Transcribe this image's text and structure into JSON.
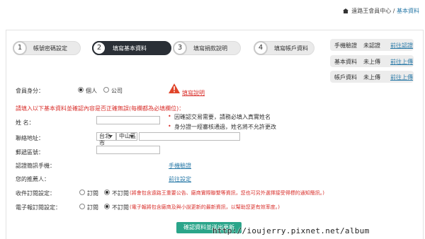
{
  "breadcrumb": {
    "home": "遠路王會員中心",
    "sep": "/",
    "current": "基本資料"
  },
  "steps": [
    {
      "num": "1",
      "label": "帳號密碼設定"
    },
    {
      "num": "2",
      "label": "填寫基本資料"
    },
    {
      "num": "3",
      "label": "填寫捐款說明"
    },
    {
      "num": "4",
      "label": "填寫帳戶資料"
    }
  ],
  "status": [
    {
      "key": "手機驗證",
      "value": "未認證",
      "action": "前往認證"
    },
    {
      "key": "基本資料",
      "value": "未上傳",
      "action": "前往上傳"
    },
    {
      "key": "帳戶資料",
      "value": "未上傳",
      "action": "前往上傳"
    }
  ],
  "form": {
    "member_label": "會員身分：",
    "member_options": [
      "個人",
      "公司"
    ],
    "member_selected": "個人",
    "explain_link": "填寫說明",
    "notice": "請填入以下基本資料並確認內容是否正確無誤(每欄都為必填欄位)：",
    "name_label": "姓 名：",
    "name_hints": [
      "因確認交易需要，請務必填入真實姓名",
      "身分證一經審核通過，姓名將不允許更改"
    ],
    "address_label": "聯絡地址：",
    "city": "台北市",
    "district": "中山區",
    "zip_label": "郵遞區號：",
    "phone_label": "認證簡訊手機：",
    "phone_link": "手機驗證",
    "recommender_label": "您的推薦人：",
    "recommender_link": "前往設定",
    "order_label": "收件訂閱設定：",
    "epaper_label": "電子報訂閱設定：",
    "sub_options": [
      "訂閱",
      "不訂閱"
    ],
    "sub_selected": "不訂閱",
    "order_note": "(將會包含遠路王重要公告、廠商實際聯繫等資訊，您也可另外選擇接受得標的通知簡訊。)",
    "epaper_note": "(電子報將包含廠商及與小說更新的最新資訊，以幫助您更有效率度。)",
    "submit": "確認資料並送出更新"
  },
  "watermark": "http://ioujerry.pixnet.net/album",
  "colors": {
    "accent": "#2a7aa8",
    "warn": "#d9302c",
    "step_active": "#2a2f36",
    "submit": "#2aa58a"
  }
}
